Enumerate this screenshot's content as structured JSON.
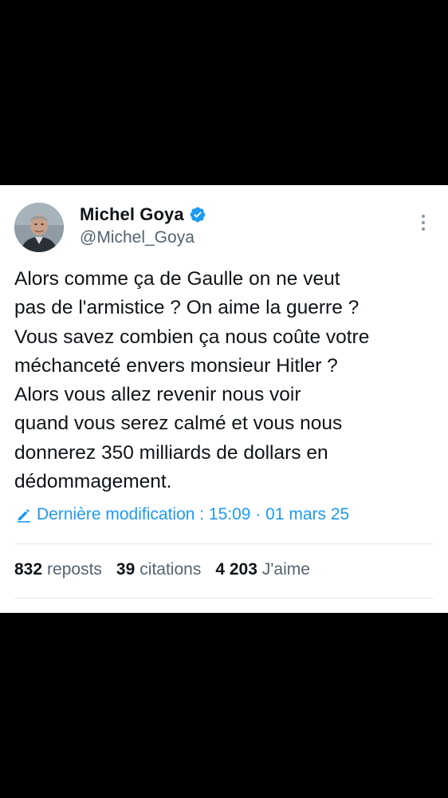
{
  "author": {
    "display_name": "Michel Goya",
    "handle": "@Michel_Goya",
    "avatar_icon": "profile-photo",
    "verified_icon": "verified-badge-icon",
    "verified_color": "#1d9bf0"
  },
  "tweet": {
    "lines": [
      "Alors comme ça de Gaulle on ne veut",
      "pas de l'armistice ? On aime la guerre ?",
      "Vous savez combien ça nous coûte votre",
      "méchanceté envers monsieur Hitler ?",
      "Alors vous allez revenir nous voir",
      "quand vous serez calmé et vous nous",
      "donnerez 350 milliards de dollars en",
      "dédommagement."
    ],
    "edited_label": "Dernière modification : 15:09 · 01 mars 25",
    "edited_icon": "pencil-icon"
  },
  "stats": {
    "reposts_count": "832",
    "reposts_label": "reposts",
    "quotes_count": "39",
    "quotes_label": "citations",
    "likes_count": "4 203",
    "likes_label": "J'aime"
  },
  "colors": {
    "link_blue": "#1d9bf0",
    "text_primary": "#0f1419",
    "text_secondary": "#536471",
    "background_outer": "#000000",
    "card_background": "#ffffff"
  }
}
